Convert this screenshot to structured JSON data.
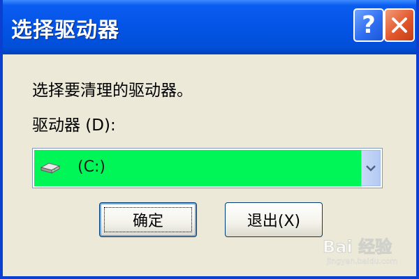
{
  "window": {
    "title": "选择驱动器",
    "help_label": "?",
    "close_label": "×"
  },
  "body": {
    "prompt": "选择要清理的驱动器。",
    "drive_label": "驱动器 (D):"
  },
  "combo": {
    "selected": "(C:)",
    "icon": "hard-drive-icon",
    "highlight_color": "#00f557"
  },
  "buttons": {
    "ok_label": "确定",
    "exit_label": "退出(X)"
  },
  "watermark": {
    "text": "Bai 经验",
    "sub": "jingyan.baidu.com"
  },
  "colors": {
    "titlebar": "#0353e6",
    "dialog_bg": "#ece9d8",
    "close_button": "#e2572c",
    "help_button": "#2f6ff2"
  }
}
